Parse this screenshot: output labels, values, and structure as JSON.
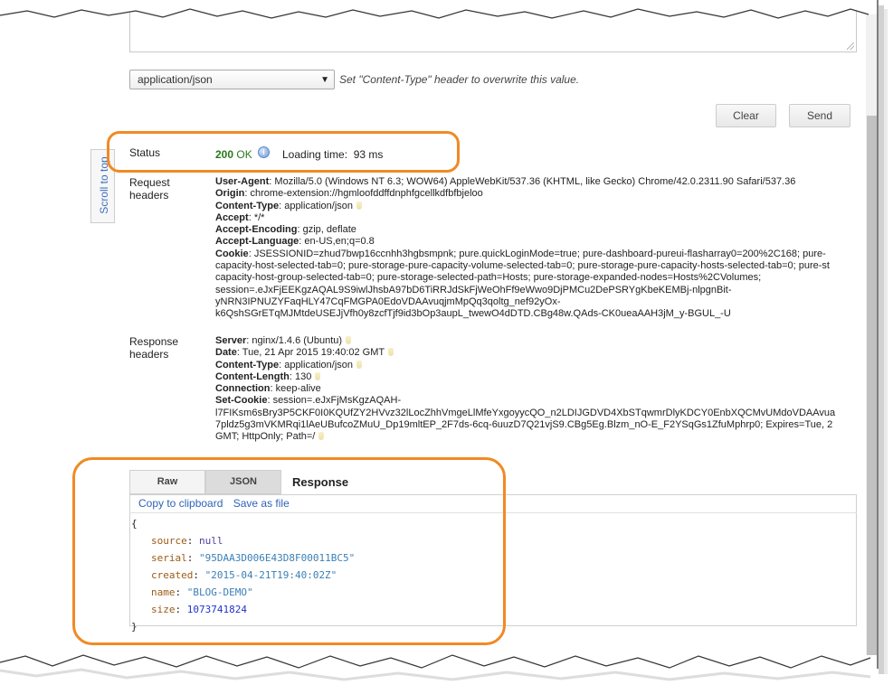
{
  "content_type": {
    "selected": "application/json",
    "hint": "Set \"Content-Type\" header to overwrite this value."
  },
  "buttons": {
    "clear": "Clear",
    "send": "Send"
  },
  "scroll_to_top": "Scroll to top",
  "status": {
    "label": "Status",
    "code": "200",
    "text": "OK",
    "loading_label": "Loading time:",
    "loading_value": "93 ms"
  },
  "request_headers": {
    "label_line1": "Request",
    "label_line2": "headers",
    "user_agent_name": "User-Agent",
    "user_agent_value": "Mozilla/5.0 (Windows NT 6.3; WOW64) AppleWebKit/537.36 (KHTML, like Gecko) Chrome/42.0.2311.90 Safari/537.36",
    "origin_name": "Origin",
    "origin_value": "chrome-extension://hgmloofddffdnphfgcellkdfbfbjeloo",
    "content_type_name": "Content-Type",
    "content_type_value": "application/json",
    "accept_name": "Accept",
    "accept_value": "*/*",
    "accept_encoding_name": "Accept-Encoding",
    "accept_encoding_value": "gzip, deflate",
    "accept_language_name": "Accept-Language",
    "accept_language_value": "en-US,en;q=0.8",
    "cookie_name": "Cookie",
    "cookie_line1": "JSESSIONID=zhud7bwp16ccnhh3hgbsmpnk; pure.quickLoginMode=true; pure-dashboard-pureui-flasharray0=200%2C168; pure-",
    "cookie_line2": "capacity-host-selected-tab=0; pure-storage-pure-capacity-volume-selected-tab=0; pure-storage-pure-capacity-hosts-selected-tab=0; pure-st",
    "cookie_line3": "capacity-host-group-selected-tab=0; pure-storage-selected-path=Hosts; pure-storage-expanded-nodes=Hosts%2CVolumes;",
    "cookie_line4": "session=.eJxFjEEKgzAQAL9S9iwlJhsbA97bD6TiRRJdSkFjWeOhFf9eWwo9DjPMCu2DePSRYgKbeKEMBj-nlpgnBit-",
    "cookie_line5": "yNRN3IPNUZYFaqHLY47CqFMGPA0EdoVDAAvuqjmMpQq3qoltg_nef92yOx-",
    "cookie_line6": "k6QshSGrETqMJMtdeUSEJjVfh0y8zcfTjf9id3bOp3aupL_twewO4dDTD.CBg48w.QAds-CK0ueaAAH3jM_y-BGUL_-U"
  },
  "response_headers": {
    "label_line1": "Response",
    "label_line2": "headers",
    "server_name": "Server",
    "server_value": "nginx/1.4.6 (Ubuntu)",
    "date_name": "Date",
    "date_value": "Tue, 21 Apr 2015 19:40:02 GMT",
    "content_type_name": "Content-Type",
    "content_type_value": "application/json",
    "content_length_name": "Content-Length",
    "content_length_value": "130",
    "connection_name": "Connection",
    "connection_value": "keep-alive",
    "set_cookie_name": "Set-Cookie",
    "set_cookie_line1": "session=.eJxFjMsKgzAQAH-",
    "set_cookie_line2": "l7FIKsm6sBry3P5CKF0I0KQUfZY2HVvz32lLocZhhVmgeLlMfeYxgoyycQO_n2LDIJGDVD4XbSTqwmrDlyKDCY0EnbXQCMvUMdoVDAAvua",
    "set_cookie_line3": "7pldz5g3mVKMRqi1lAeUBufcoZMuU_Dp19mltEP_2F7ds-6cq-6uuzD7Q21vjS9.CBg5Eg.Blzm_nO-E_F2YSqGs1ZfuMphrp0; Expires=Tue, 2",
    "set_cookie_line4": "GMT; HttpOnly; Path=/"
  },
  "response": {
    "tabs": [
      "Raw",
      "JSON"
    ],
    "title": "Response",
    "links": [
      "Copy to clipboard",
      "Save as file"
    ],
    "open_brace": "{",
    "close_brace": "}",
    "fields": [
      {
        "key": "source",
        "value": "null",
        "kind": "null"
      },
      {
        "key": "serial",
        "value": "\"95DAA3D006E43D8F00011BC5\"",
        "kind": "string"
      },
      {
        "key": "created",
        "value": "\"2015-04-21T19:40:02Z\"",
        "kind": "string"
      },
      {
        "key": "name",
        "value": "\"BLOG-DEMO\"",
        "kind": "string"
      },
      {
        "key": "size",
        "value": "1073741824",
        "kind": "number"
      }
    ]
  },
  "colors": {
    "highlight": "#f08a24",
    "status_ok": "#2a7a1a",
    "link": "#2f63b8"
  },
  "icons": [
    "info-icon",
    "dropdown-arrow-icon",
    "resize-grip-icon",
    "header-hint-icon"
  ]
}
